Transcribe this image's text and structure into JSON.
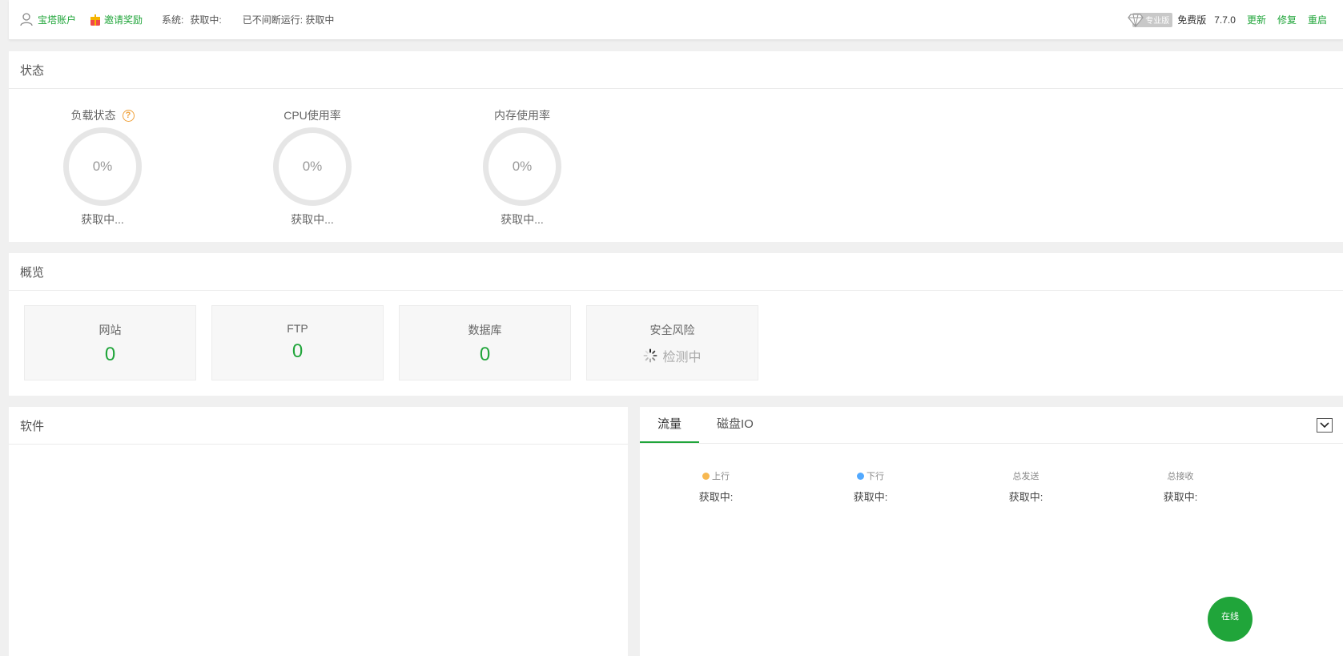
{
  "topbar": {
    "account": "宝塔账户",
    "invite": "邀请奖励",
    "system_label": "系统:",
    "system_value": "获取中:",
    "uptime": "已不间断运行: 获取中",
    "pro_badge": "专业版",
    "edition": "免费版",
    "version": "7.7.0",
    "update": "更新",
    "repair": "修复",
    "restart": "重启"
  },
  "status": {
    "title": "状态",
    "gauges": [
      {
        "title": "负载状态",
        "value": "0%",
        "sub": "获取中..."
      },
      {
        "title": "CPU使用率",
        "value": "0%",
        "sub": "获取中..."
      },
      {
        "title": "内存使用率",
        "value": "0%",
        "sub": "获取中..."
      }
    ]
  },
  "overview": {
    "title": "概览",
    "cards": [
      {
        "label": "网站",
        "value": "0"
      },
      {
        "label": "FTP",
        "value": "0"
      },
      {
        "label": "数据库",
        "value": "0"
      },
      {
        "label": "安全风险",
        "value": "检测中"
      }
    ]
  },
  "software": {
    "title": "软件"
  },
  "traffic": {
    "tabs": [
      "流量",
      "磁盘IO"
    ],
    "stats": [
      {
        "label": "上行",
        "value": "获取中:",
        "color": "#f7b851"
      },
      {
        "label": "下行",
        "value": "获取中:",
        "color": "#52a9ff"
      },
      {
        "label": "总发送",
        "value": "获取中:"
      },
      {
        "label": "总接收",
        "value": "获取中:"
      }
    ]
  },
  "online_service": "在线"
}
